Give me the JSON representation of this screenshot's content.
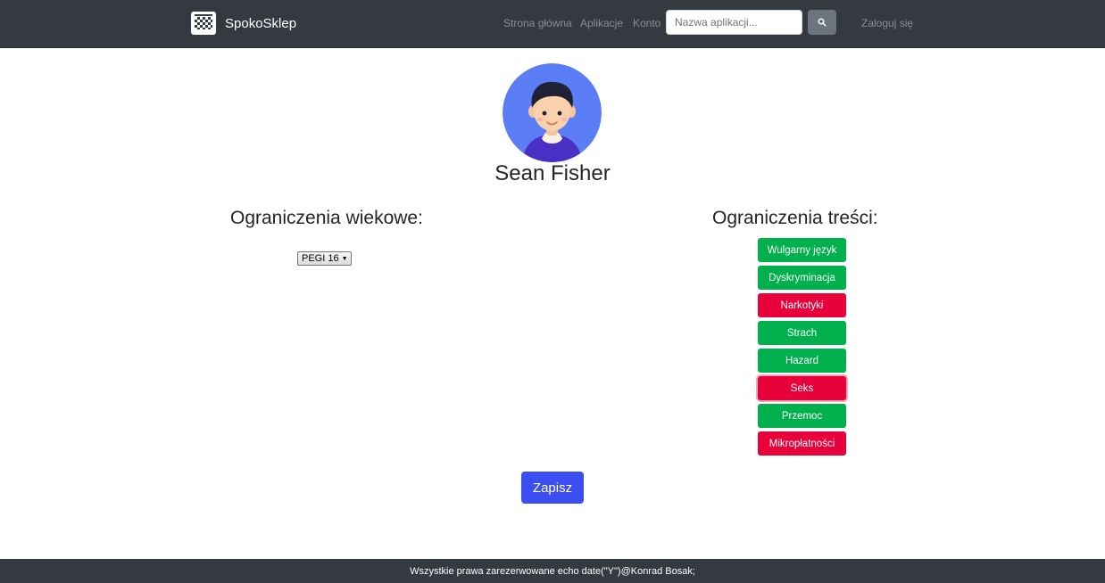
{
  "navbar": {
    "brand": "SpokoSklep",
    "links": [
      "Strona główna",
      "Aplikacje",
      "Konto"
    ],
    "search_placeholder": "Nazwa aplikacji...",
    "search_value": "",
    "login": "Zaloguj się"
  },
  "profile": {
    "name": "Sean Fisher"
  },
  "age_restrictions": {
    "title": "Ograniczenia wiekowe:",
    "selected": "PEGI 16"
  },
  "content_restrictions": {
    "title": "Ograniczenia treści:",
    "items": [
      {
        "label": "Wulgarny język",
        "state": "allowed"
      },
      {
        "label": "Dyskryminacja",
        "state": "allowed"
      },
      {
        "label": "Narkotyki",
        "state": "blocked"
      },
      {
        "label": "Strach",
        "state": "allowed"
      },
      {
        "label": "Hazard",
        "state": "allowed"
      },
      {
        "label": "Seks",
        "state": "blocked"
      },
      {
        "label": "Przemoc",
        "state": "allowed"
      },
      {
        "label": "Mikropłatności",
        "state": "blocked"
      }
    ]
  },
  "save_label": "Zapisz",
  "footer": "Wszystkie prawa zarezerwowane echo date(\"Y\")@Konrad Bosak;",
  "colors": {
    "navbar": "#343a40",
    "allowed": "#00b04c",
    "blocked": "#e8003a",
    "primary": "#3a4ef2"
  }
}
